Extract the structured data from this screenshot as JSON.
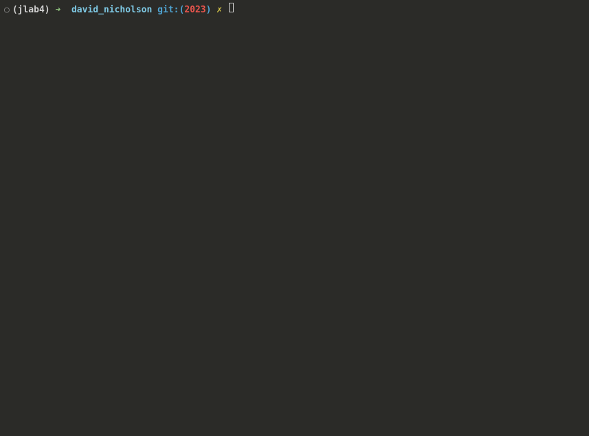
{
  "prompt": {
    "status_dot": "○",
    "env_open": "(",
    "env_name": "jlab4",
    "env_close": ")",
    "arrow": "➜",
    "directory": "david_nicholson",
    "git_label": "git:",
    "git_paren_open": "(",
    "branch": "2023",
    "git_paren_close": ")",
    "dirty_marker": "✗"
  }
}
